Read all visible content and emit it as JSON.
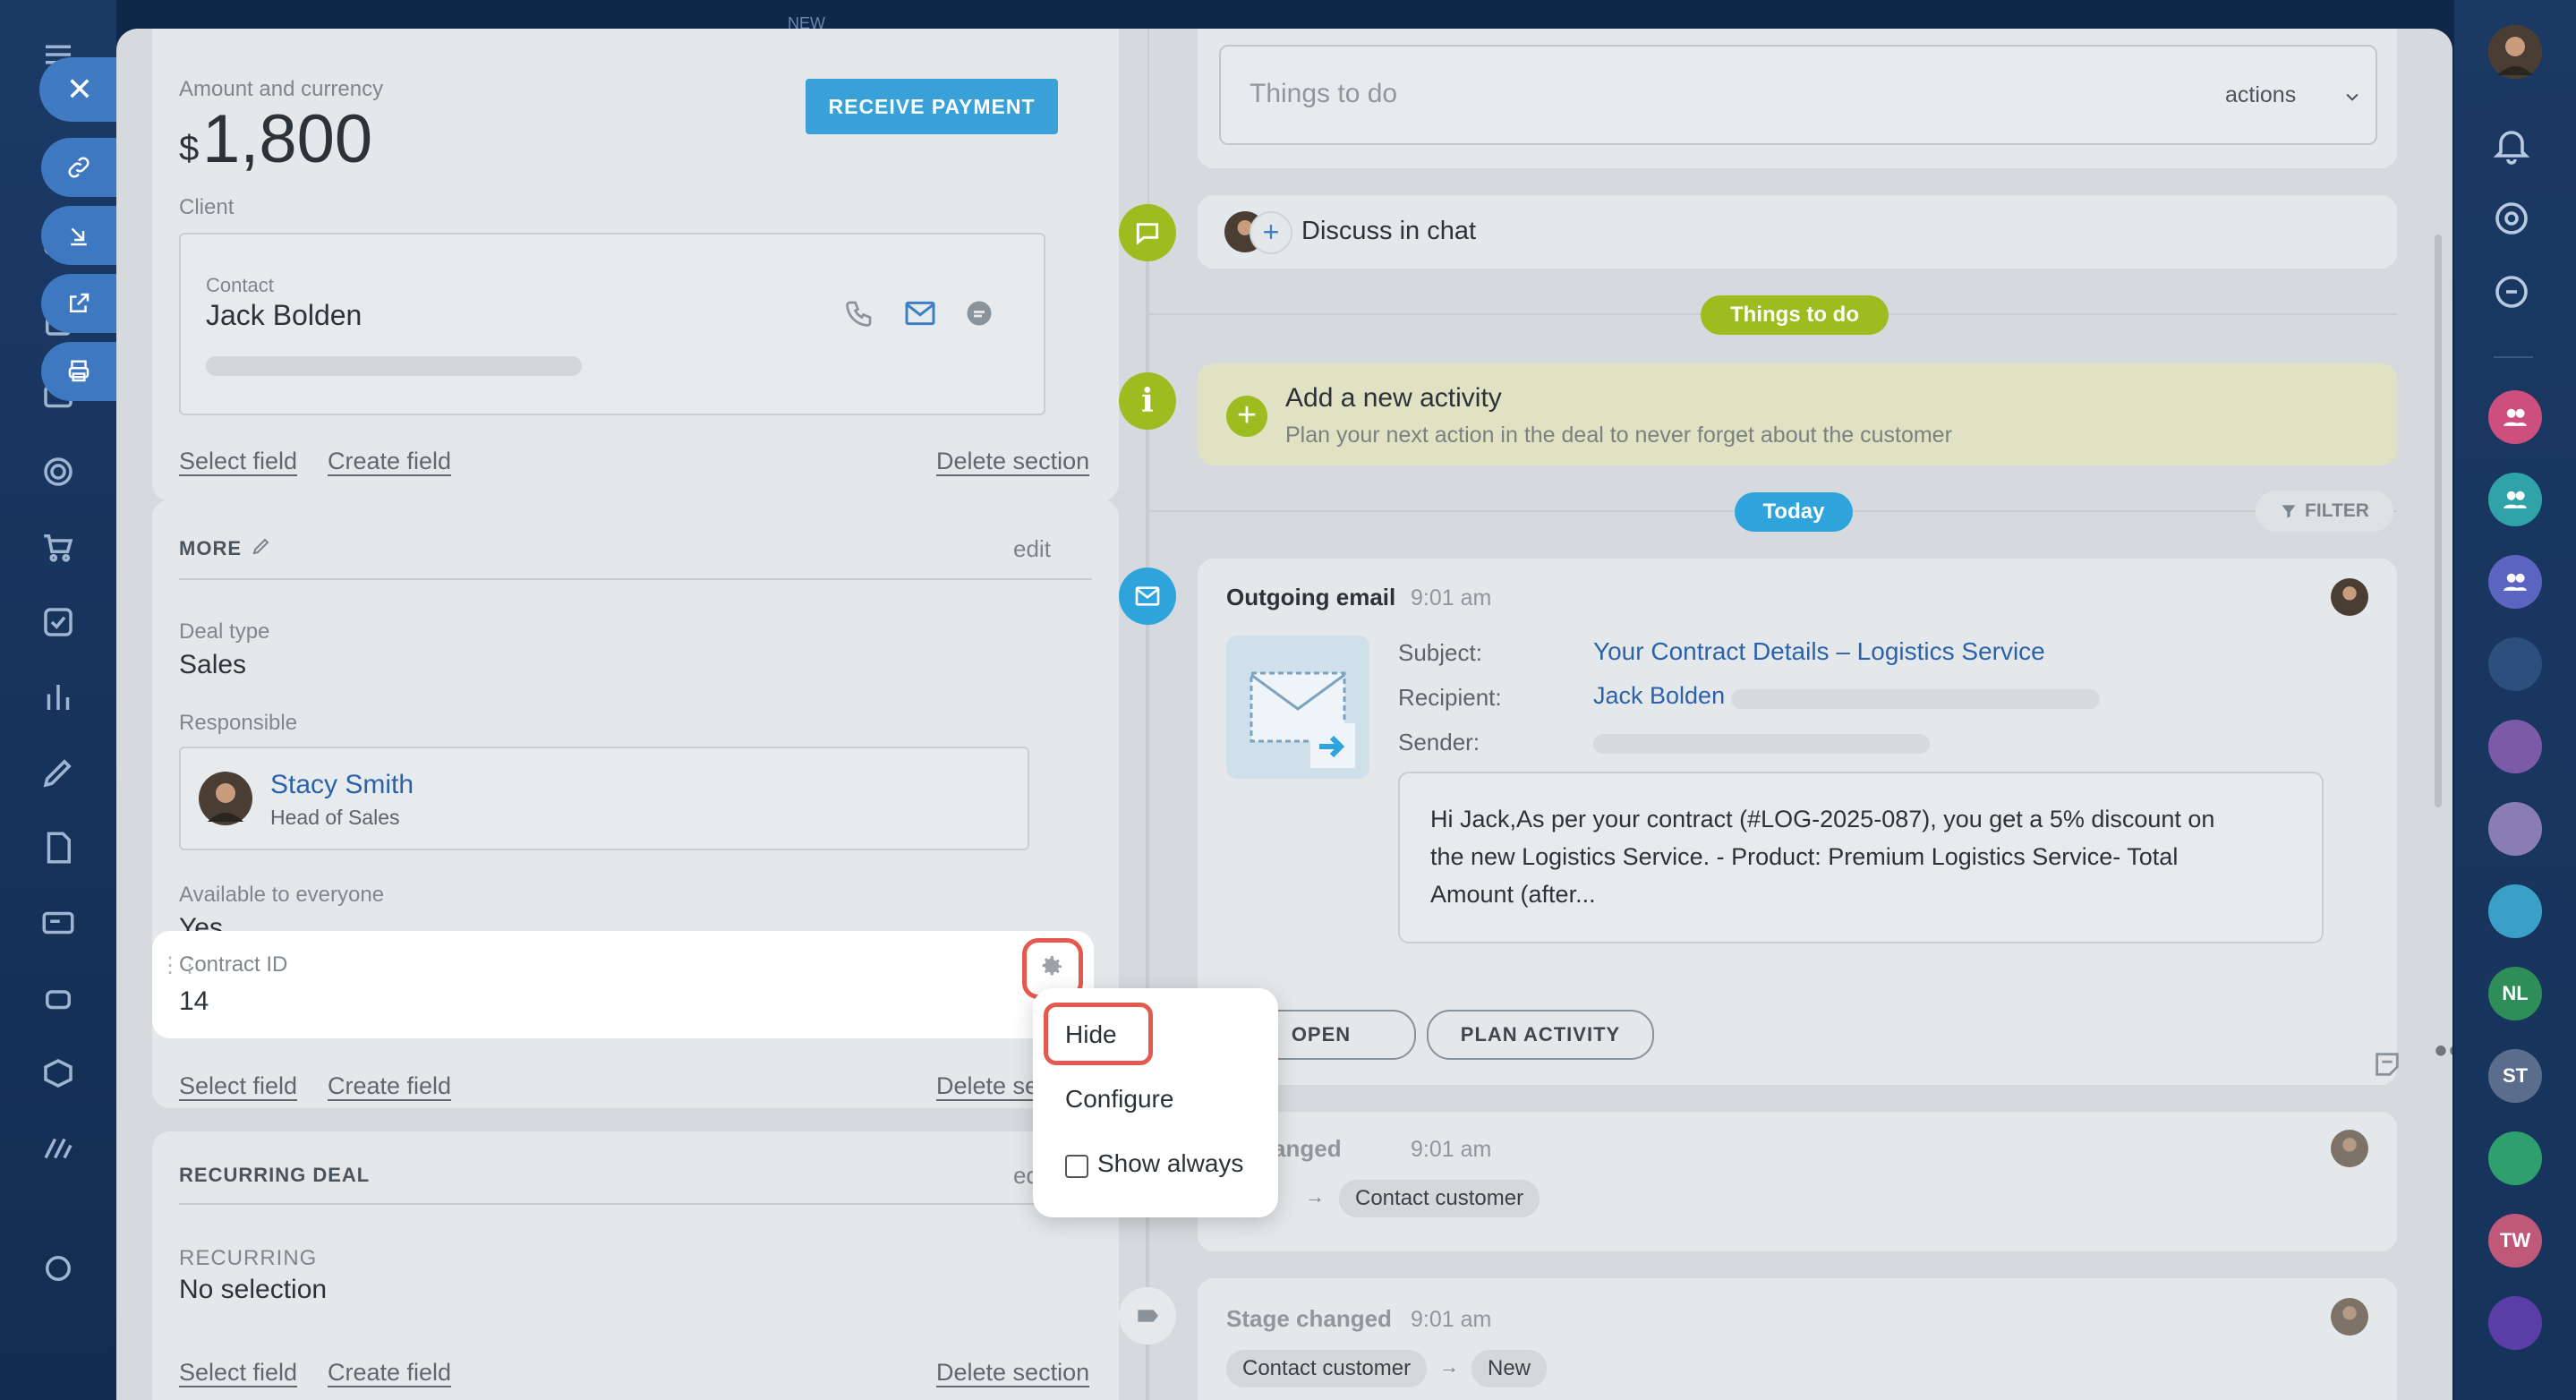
{
  "top_hint": "NEW",
  "left_panel": {
    "amount_label": "Amount and currency",
    "currency_symbol": "$",
    "amount": "1,800",
    "receive_payment": "RECEIVE PAYMENT",
    "client_label": "Client",
    "contact_label": "Contact",
    "contact_name": "Jack Bolden",
    "select_field": "Select field",
    "create_field": "Create field",
    "delete_section": "Delete section",
    "more_section": {
      "title": "MORE",
      "edit": "edit",
      "deal_type_label": "Deal type",
      "deal_type": "Sales",
      "responsible_label": "Responsible",
      "responsible_name": "Stacy Smith",
      "responsible_role": "Head of Sales",
      "available_label": "Available to everyone",
      "available_value": "Yes",
      "contract_label": "Contract ID",
      "contract_value": "14",
      "select_field": "Select field",
      "create_field": "Create field",
      "delete_section": "Delete secti"
    },
    "recurring_section": {
      "title": "RECURRING DEAL",
      "edit": "ed",
      "recurring_label": "RECURRING",
      "recurring_value": "No selection",
      "select_field": "Select field",
      "create_field": "Create field",
      "delete_section": "Delete section"
    }
  },
  "context_menu": {
    "hide": "Hide",
    "configure": "Configure",
    "show_always": "Show always"
  },
  "timeline": {
    "todo_placeholder": "Things to do",
    "actions": "actions",
    "discuss_chat": "Discuss in chat",
    "things_to_do_pill": "Things to do",
    "add_activity_title": "Add a new activity",
    "add_activity_sub": "Plan your next action in the deal to never forget about the customer",
    "today_pill": "Today",
    "filter": "FILTER",
    "email": {
      "title": "Outgoing email",
      "time": "9:01 am",
      "subject_label": "Subject:",
      "subject": "Your Contract Details – Logistics Service",
      "recipient_label": "Recipient:",
      "recipient": "Jack Bolden",
      "sender_label": "Sender:",
      "body": "Hi Jack,As per your contract (#LOG-2025-087), you get a 5% discount on the new Logistics Service. - Product: Premium Logistics Service- Total Amount (after...",
      "open_btn": "OPEN",
      "plan_btn": "PLAN ACTIVITY"
    },
    "stage1": {
      "title": "e changed",
      "time": "9:01 am",
      "from": "w",
      "to": "Contact customer"
    },
    "stage2": {
      "title": "Stage changed",
      "time": "9:01 am",
      "from": "Contact customer",
      "to": "New"
    }
  },
  "right_bar": {
    "avatars": [
      "NL",
      "ST",
      "TW"
    ]
  },
  "colors": {
    "accent_blue": "#2fa4dc",
    "green": "#9fbf1e",
    "highlight_red": "#e55a4e"
  }
}
